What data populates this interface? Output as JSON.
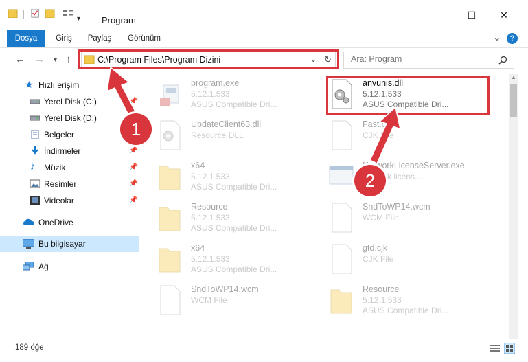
{
  "window": {
    "title": "Program",
    "buttons": {
      "minimize": "—",
      "maximize": "☐",
      "close": "✕"
    },
    "qat_dropdown": "▾"
  },
  "ribbon": {
    "tabs": [
      "Dosya",
      "Giriş",
      "Paylaş",
      "Görünüm"
    ],
    "active_tab": "Dosya",
    "expand": "⌄",
    "help": "?"
  },
  "address_bar": {
    "back": "←",
    "forward": "→",
    "history": "▾",
    "up": "↑",
    "path": "C:\\Program Files\\Program Dizini",
    "dropdown": "⌄",
    "refresh": "↻"
  },
  "search": {
    "placeholder": "Ara: Program"
  },
  "sidebar": {
    "items": [
      {
        "label": "Hızlı erişim",
        "icon": "star-icon",
        "pinned": false
      },
      {
        "label": "Yerel Disk (C:)",
        "icon": "drive-icon",
        "pinned": true
      },
      {
        "label": "Yerel Disk (D:)",
        "icon": "drive-icon",
        "pinned": false
      },
      {
        "label": "Belgeler",
        "icon": "documents-icon",
        "pinned": true
      },
      {
        "label": "İndirmeler",
        "icon": "downloads-icon",
        "pinned": true
      },
      {
        "label": "Müzik",
        "icon": "music-icon",
        "pinned": true
      },
      {
        "label": "Resimler",
        "icon": "pictures-icon",
        "pinned": true
      },
      {
        "label": "Videolar",
        "icon": "videos-icon",
        "pinned": true
      },
      {
        "label": "OneDrive",
        "icon": "cloud-icon",
        "pinned": false
      },
      {
        "label": "Bu bilgisayar",
        "icon": "computer-icon",
        "pinned": false,
        "selected": true
      },
      {
        "label": "Ağ",
        "icon": "network-icon",
        "pinned": false
      }
    ]
  },
  "files": [
    {
      "name": "program.exe",
      "line2": "5.12.1.533",
      "line3": "ASUS Compatible Dri...",
      "icon": "exe-icon"
    },
    {
      "name": "anvunis.dll",
      "line2": "5.12.1.533",
      "line3": "ASUS Compatible Dri...",
      "icon": "dll-gear-icon",
      "highlighted": true
    },
    {
      "name": "UpdateClient63.dll",
      "line2": "Resource DLL",
      "line3": "",
      "icon": "dll-gear-icon"
    },
    {
      "name": "Fast.cjk",
      "line2": "CJK File",
      "line3": "",
      "icon": "blank-file-icon"
    },
    {
      "name": "x64",
      "line2": "5.12.1.533",
      "line3": "ASUS Compatible Dri...",
      "icon": "folder-icon"
    },
    {
      "name": "NetworkLicenseServer.exe",
      "line2": "network licens...",
      "line3": "",
      "icon": "window-exe-icon"
    },
    {
      "name": "Resource",
      "line2": "5.12.1.533",
      "line3": "ASUS Compatible Dri...",
      "icon": "folder-icon"
    },
    {
      "name": "SndToWP14.wcm",
      "line2": "WCM File",
      "line3": "",
      "icon": "blank-file-icon"
    },
    {
      "name": "x64",
      "line2": "5.12.1.533",
      "line3": "ASUS Compatible Dri...",
      "icon": "folder-icon"
    },
    {
      "name": "gtd.cjk",
      "line2": "CJK File",
      "line3": "",
      "icon": "blank-file-icon"
    },
    {
      "name": "SndToWP14.wcm",
      "line2": "WCM File",
      "line3": "",
      "icon": "blank-file-icon"
    },
    {
      "name": "Resource",
      "line2": "5.12.1.533",
      "line3": "ASUS Compatible Dri...",
      "icon": "folder-icon"
    }
  ],
  "status": {
    "count": "189 öğe"
  },
  "annotations": {
    "badge1": "1",
    "badge2": "2",
    "color": "#d8353c"
  },
  "colors": {
    "accent": "#1979ca",
    "annotation": "#d8353c",
    "folder": "#f3c94a",
    "selection": "#cce8ff"
  }
}
